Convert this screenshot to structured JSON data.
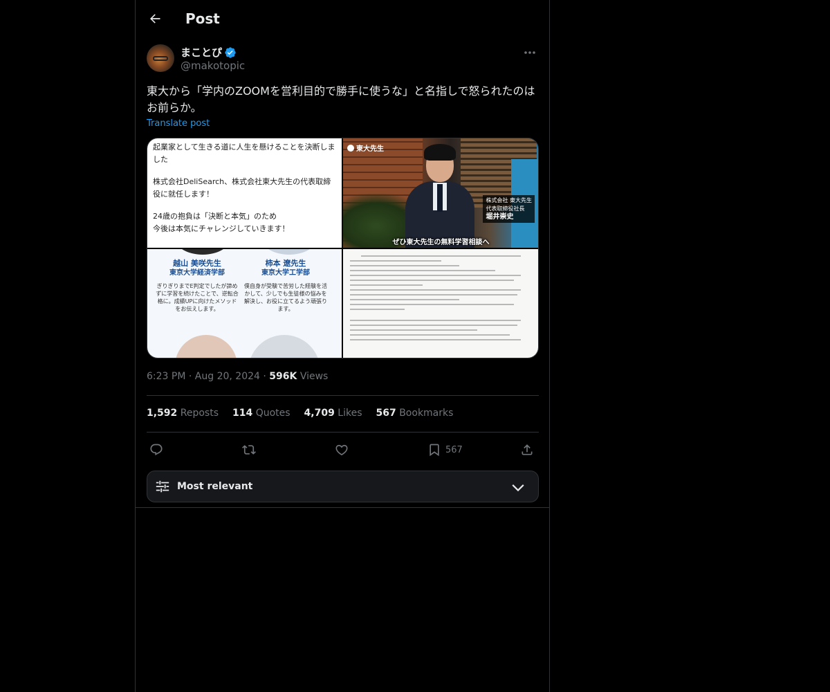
{
  "header": {
    "title": "Post"
  },
  "author": {
    "display_name": "まことぴ",
    "handle": "@makotopic",
    "verified_color": "#1d9bf0"
  },
  "post": {
    "text": "東大から「学内のZOOMを営利目的で勝手に使うな」と名指しで怒られたのはお前らか。",
    "translate_label": "Translate post"
  },
  "media": {
    "tile1": {
      "lines": [
        "起業家として生きる道に人生を懸けることを決断しました",
        "株式会社DeliSearch、株式会社東大先生の代表取締役に就任します！",
        "24歳の抱負は「決断と本気」のため",
        "今後は本気にチャレンジしていきます！"
      ]
    },
    "tile2": {
      "badge": "東大先生",
      "caption_company": "株式会社 東大先生",
      "caption_title": "代表取締役社長",
      "caption_name": "堀井崇史",
      "subtitle": "ぜひ東大先生の無料学習相談へ"
    },
    "tile3": {
      "teachers": [
        {
          "name": "越山 美咲先生",
          "school": "東京大学経済学部",
          "desc": "ぎりぎりまでE判定でしたが諦めずに学習を続けたことで、逆転合格に。成績UPに向けたメソッドをお伝えします。"
        },
        {
          "name": "柿本 遼先生",
          "school": "東京大学工学部",
          "desc": "僕自身が受験で苦労した経験を活かして、少しでも生徒様の悩みを解決し、お役に立てるよう頑張ります。"
        }
      ]
    }
  },
  "meta": {
    "time": "6:23 PM",
    "date": "Aug 20, 2024",
    "views_count": "596K",
    "views_label": "Views",
    "separator": "·"
  },
  "stats": [
    {
      "count": "1,592",
      "label": "Reposts"
    },
    {
      "count": "114",
      "label": "Quotes"
    },
    {
      "count": "4,709",
      "label": "Likes"
    },
    {
      "count": "567",
      "label": "Bookmarks"
    }
  ],
  "actions": {
    "reply_icon": "reply-icon",
    "repost_icon": "repost-icon",
    "like_icon": "heart-icon",
    "bookmark_icon": "bookmark-icon",
    "bookmark_count": "567",
    "share_icon": "share-icon"
  },
  "sort": {
    "label": "Most relevant"
  },
  "colors": {
    "background": "#000000",
    "text": "#e7e9ea",
    "muted": "#71767b",
    "accent": "#1d9bf0",
    "border": "#2f3336"
  }
}
